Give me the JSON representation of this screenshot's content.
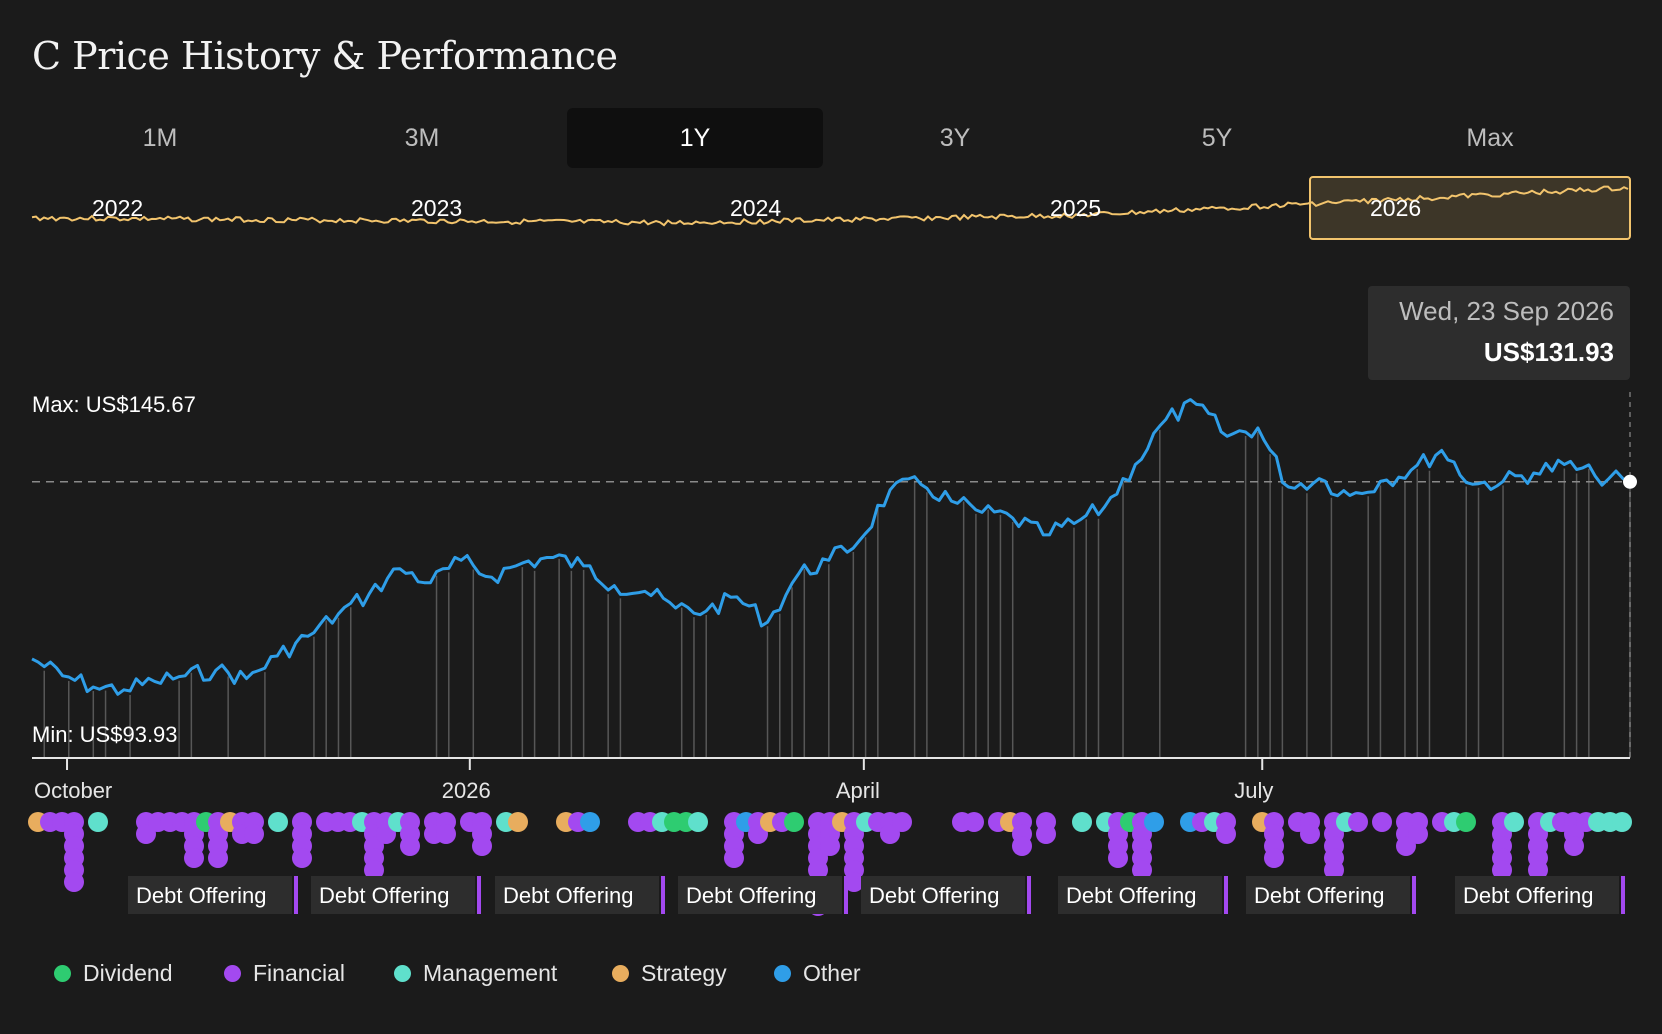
{
  "title": "C Price History & Performance",
  "tabs": [
    {
      "label": "1M",
      "active": false
    },
    {
      "label": "3M",
      "active": false
    },
    {
      "label": "1Y",
      "active": true
    },
    {
      "label": "3Y",
      "active": false
    },
    {
      "label": "5Y",
      "active": false
    },
    {
      "label": "Max",
      "active": false
    }
  ],
  "overview": {
    "year_labels": [
      "2022",
      "2023",
      "2024",
      "2025",
      "2026"
    ],
    "line_color": "#f2c46d",
    "selected_range": "1Y"
  },
  "tooltip": {
    "date": "Wed, 23 Sep 2026",
    "price": "US$131.93"
  },
  "chart_data": {
    "type": "line",
    "series": [
      {
        "color": "#2f9ee8",
        "x": [
          "2025-09-23",
          "2025-09-30",
          "2025-10-07",
          "2025-10-14",
          "2025-10-21",
          "2025-10-28",
          "2025-11-04",
          "2025-11-11",
          "2025-11-18",
          "2025-11-25",
          "2025-12-02",
          "2025-12-09",
          "2025-12-16",
          "2025-12-23",
          "2025-12-30",
          "2026-01-06",
          "2026-01-13",
          "2026-01-20",
          "2026-01-27",
          "2026-02-03",
          "2026-02-10",
          "2026-02-17",
          "2026-02-24",
          "2026-03-03",
          "2026-03-10",
          "2026-03-17",
          "2026-03-24",
          "2026-03-31",
          "2026-04-07",
          "2026-04-14",
          "2026-04-21",
          "2026-04-28",
          "2026-05-05",
          "2026-05-12",
          "2026-05-19",
          "2026-05-26",
          "2026-06-02",
          "2026-06-09",
          "2026-06-16",
          "2026-06-23",
          "2026-06-30",
          "2026-07-07",
          "2026-07-14",
          "2026-07-21",
          "2026-07-28",
          "2026-08-04",
          "2026-08-11",
          "2026-08-18",
          "2026-08-25",
          "2026-09-01",
          "2026-09-08",
          "2026-09-15",
          "2026-09-23"
        ],
        "values": [
          100.5,
          97.5,
          95.5,
          95.0,
          96.5,
          97.5,
          98.5,
          97.0,
          101.0,
          104.5,
          108.5,
          112.0,
          116.5,
          114.0,
          118.0,
          115.0,
          117.5,
          118.5,
          117.0,
          113.5,
          112.5,
          109.5,
          109.0,
          111.5,
          107.0,
          115.5,
          118.0,
          121.5,
          130.5,
          131.5,
          128.5,
          126.5,
          125.5,
          122.5,
          124.5,
          127.5,
          135.0,
          143.0,
          145.67,
          140.0,
          141.5,
          131.0,
          132.5,
          129.5,
          132.0,
          134.0,
          137.5,
          131.5,
          132.0,
          133.5,
          135.0,
          133.0,
          131.93
        ]
      }
    ],
    "ylim": [
      90,
      150
    ],
    "x_tick_labels": [
      "October",
      "2026",
      "April",
      "July"
    ],
    "annotations": {
      "max_label": "Max: US$145.67",
      "min_label": "Min: US$93.93",
      "reference_price": 131.93
    },
    "events": {
      "categories": [
        {
          "name": "Dividend",
          "color": "#2ecc71"
        },
        {
          "name": "Financial",
          "color": "#a349f0"
        },
        {
          "name": "Management",
          "color": "#5fe0cc"
        },
        {
          "name": "Strategy",
          "color": "#e8ad5e"
        },
        {
          "name": "Other",
          "color": "#2f9ee8"
        }
      ],
      "callouts": [
        "Debt Offering",
        "Debt Offering",
        "Debt Offering",
        "Debt Offering",
        "Debt Offering",
        "Debt Offering",
        "Debt Offering",
        "Debt Offering"
      ]
    },
    "legend_position": "bottom-left"
  }
}
